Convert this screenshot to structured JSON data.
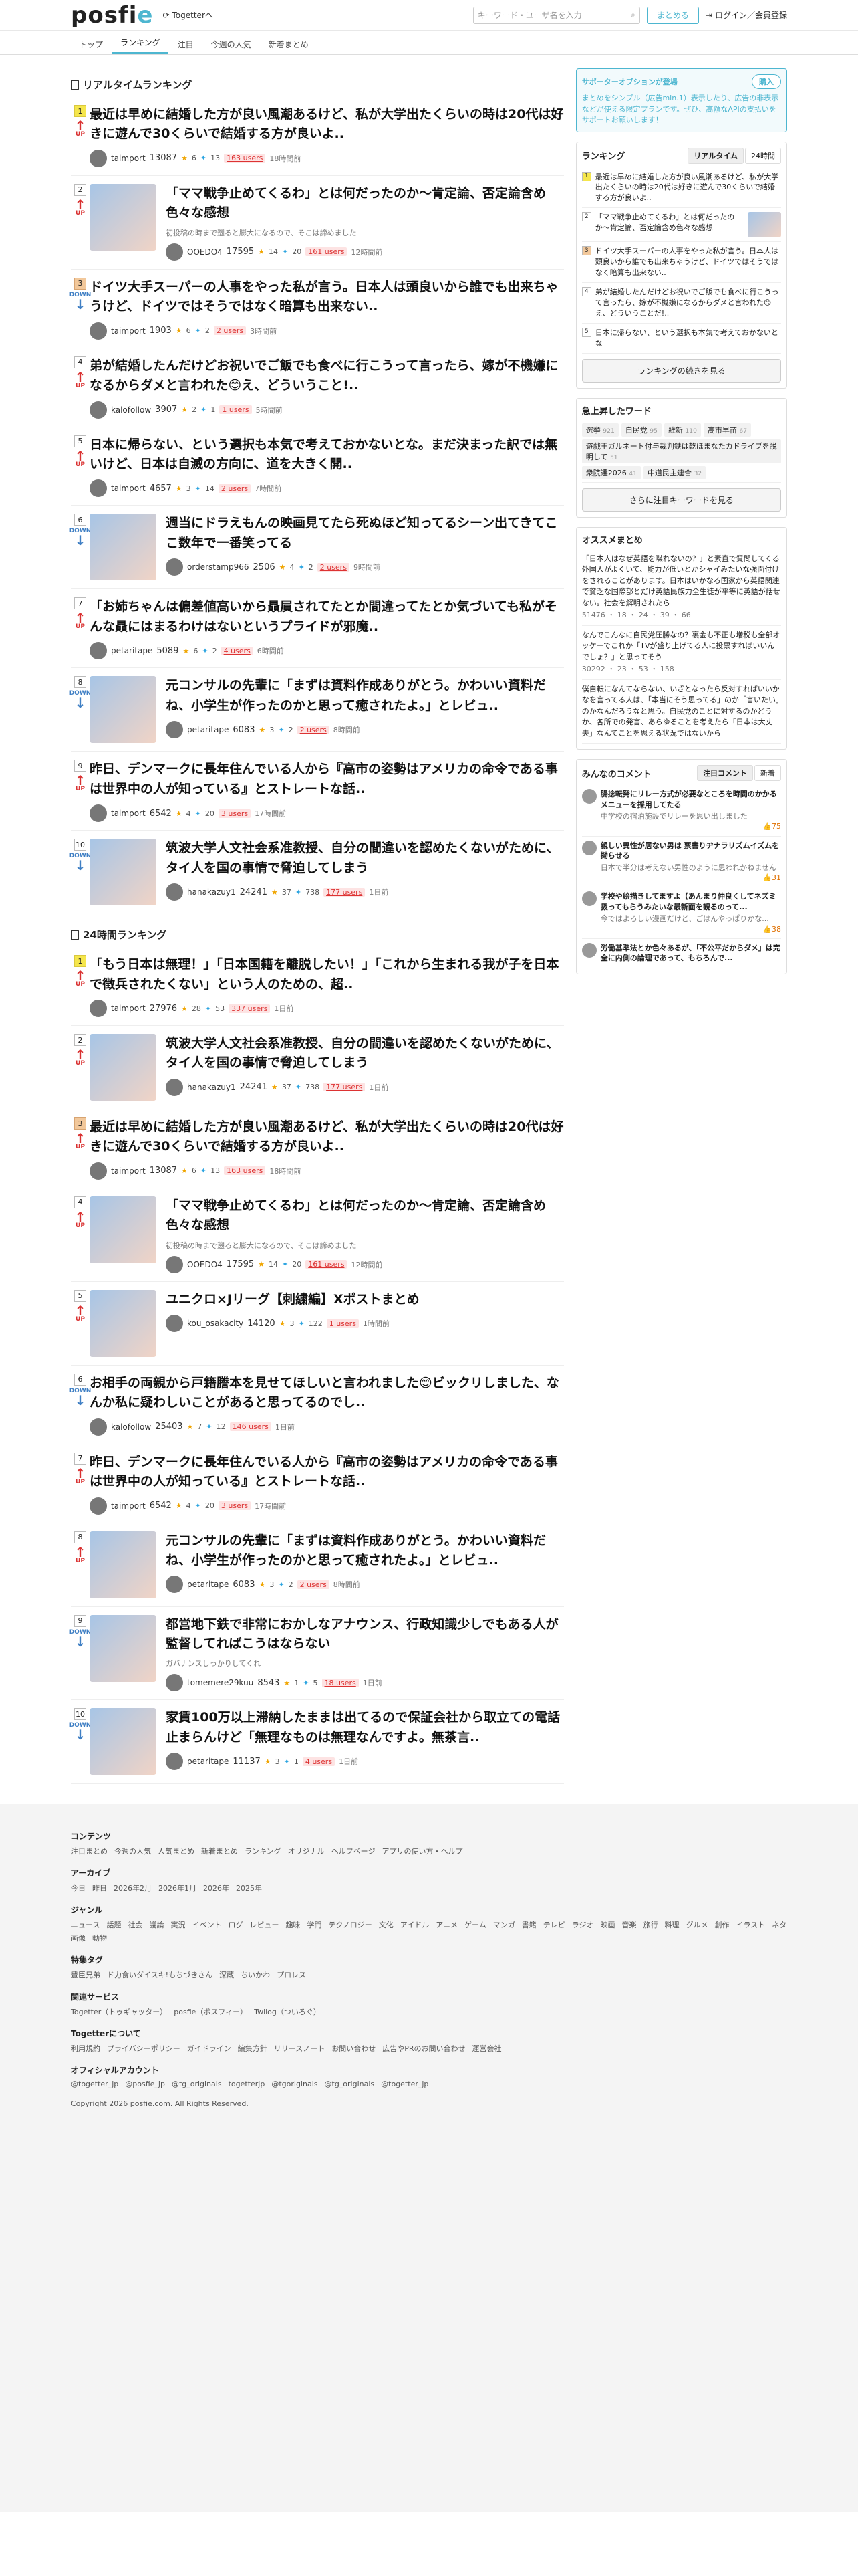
{
  "header": {
    "logo_main": "posfi",
    "logo_e": "e",
    "togetter_link": "Togetterへ",
    "search_placeholder": "キーワード・ユーザ名を入力",
    "matome_button": "まとめる",
    "login_label": "ログイン／会員登録"
  },
  "nav": [
    "トップ",
    "ランキング",
    "注目",
    "今週の人気",
    "新着まとめ"
  ],
  "realtime": {
    "title": "リアルタイムランキング",
    "items": [
      {
        "rank": "1",
        "trend": "UP",
        "title": "最近は早めに結婚した方が良い風潮あるけど、私が大学出たくらいの時は20代は好きに遊んで30くらいで結婚する方が良いよ..",
        "desc": "",
        "user": "taimport",
        "views": "13087",
        "likes": "6",
        "tw": "13",
        "users": "163 users",
        "time": "18時間前",
        "thumb": false
      },
      {
        "rank": "2",
        "trend": "UP",
        "title": "「ママ戦争止めてくるわ」とは何だったのか〜肯定論、否定論含め色々な感想",
        "desc": "初投稿の時まで遡ると膨大になるので、そこは諦めました",
        "user": "OOEDO4",
        "views": "17595",
        "likes": "14",
        "tw": "20",
        "users": "161 users",
        "time": "12時間前",
        "thumb": true
      },
      {
        "rank": "3",
        "trend": "DOWN",
        "title": "ドイツ大手スーパーの人事をやった私が言う。日本人は頭良いから誰でも出来ちゃうけど、ドイツではそうではなく暗算も出来ない..",
        "desc": "",
        "user": "taimport",
        "views": "1903",
        "likes": "6",
        "tw": "2",
        "users": "2 users",
        "time": "3時間前",
        "thumb": false
      },
      {
        "rank": "4",
        "trend": "UP",
        "title": "弟が結婚したんだけどお祝いでご飯でも食べに行こうって言ったら、嫁が不機嫌になるからダメと言われた😊え、どういうこと!..",
        "desc": "",
        "user": "kalofollow",
        "views": "3907",
        "likes": "2",
        "tw": "1",
        "users": "1 users",
        "time": "5時間前",
        "thumb": false
      },
      {
        "rank": "5",
        "trend": "UP",
        "title": "日本に帰らない、という選択も本気で考えておかないとな。まだ決まった訳では無いけど、日本は自滅の方向に、道を大きく開..",
        "desc": "",
        "user": "taimport",
        "views": "4657",
        "likes": "3",
        "tw": "14",
        "users": "2 users",
        "time": "7時間前",
        "thumb": false
      },
      {
        "rank": "6",
        "trend": "DOWN",
        "title": "週当にドラえもんの映画見てたら死ぬほど知ってるシーン出てきてここ数年で一番笑ってる",
        "desc": "",
        "user": "orderstamp966",
        "views": "2506",
        "likes": "4",
        "tw": "2",
        "users": "2 users",
        "time": "9時間前",
        "thumb": true
      },
      {
        "rank": "7",
        "trend": "UP",
        "title": "「お姉ちゃんは偏差値高いから贔屓されてたとか間違ってたとか気づいても私がそんな贔にはまるわけはないというプライドが邪魔..",
        "desc": "",
        "user": "petaritape",
        "views": "5089",
        "likes": "6",
        "tw": "2",
        "users": "4 users",
        "time": "6時間前",
        "thumb": false
      },
      {
        "rank": "8",
        "trend": "DOWN",
        "title": "元コンサルの先輩に「まずは資料作成ありがとう。かわいい資料だね、小学生が作ったのかと思って癒されたよ。」とレビュ..",
        "desc": "",
        "user": "petaritape",
        "views": "6083",
        "likes": "3",
        "tw": "2",
        "users": "2 users",
        "time": "8時間前",
        "thumb": true
      },
      {
        "rank": "9",
        "trend": "UP",
        "title": "昨日、デンマークに長年住んでいる人から『高市の姿勢はアメリカの命令である事は世界中の人が知っている』とストレートな話..",
        "desc": "",
        "user": "taimport",
        "views": "6542",
        "likes": "4",
        "tw": "20",
        "users": "3 users",
        "time": "17時間前",
        "thumb": false
      },
      {
        "rank": "10",
        "trend": "DOWN",
        "title": "筑波大学人文社会系准教授、自分の間違いを認めたくないがために、タイ人を国の事情で脅迫してしまう",
        "desc": "",
        "user": "hanakazuy1",
        "views": "24241",
        "likes": "37",
        "tw": "738",
        "users": "177 users",
        "time": "1日前",
        "thumb": true
      }
    ]
  },
  "daily": {
    "title": "24時間ランキング",
    "items": [
      {
        "rank": "1",
        "trend": "UP",
        "title": "「もう日本は無理！」「日本国籍を離脱したい！」「これから生まれる我が子を日本で徴兵されたくない」という人のための、超..",
        "desc": "",
        "user": "taimport",
        "views": "27976",
        "likes": "28",
        "tw": "53",
        "users": "337 users",
        "time": "1日前",
        "thumb": false
      },
      {
        "rank": "2",
        "trend": "UP",
        "title": "筑波大学人文社会系准教授、自分の間違いを認めたくないがために、タイ人を国の事情で脅迫してしまう",
        "desc": "",
        "user": "hanakazuy1",
        "views": "24241",
        "likes": "37",
        "tw": "738",
        "users": "177 users",
        "time": "1日前",
        "thumb": true
      },
      {
        "rank": "3",
        "trend": "UP",
        "title": "最近は早めに結婚した方が良い風潮あるけど、私が大学出たくらいの時は20代は好きに遊んで30くらいで結婚する方が良いよ..",
        "desc": "",
        "user": "taimport",
        "views": "13087",
        "likes": "6",
        "tw": "13",
        "users": "163 users",
        "time": "18時間前",
        "thumb": false
      },
      {
        "rank": "4",
        "trend": "UP",
        "title": "「ママ戦争止めてくるわ」とは何だったのか〜肯定論、否定論含め色々な感想",
        "desc": "初投稿の時まで遡ると膨大になるので、そこは諦めました",
        "user": "OOEDO4",
        "views": "17595",
        "likes": "14",
        "tw": "20",
        "users": "161 users",
        "time": "12時間前",
        "thumb": true
      },
      {
        "rank": "5",
        "trend": "UP",
        "title": "ユニクロ×Jリーグ【刺繍編】Xポストまとめ",
        "desc": "",
        "user": "kou_osakacity",
        "views": "14120",
        "likes": "3",
        "tw": "122",
        "users": "1 users",
        "time": "1時間前",
        "thumb": true
      },
      {
        "rank": "6",
        "trend": "DOWN",
        "title": "お相手の両親から戸籍謄本を見せてほしいと言われました😊ビックリしました、なんか私に疑わしいことがあると思ってるのでし..",
        "desc": "",
        "user": "kalofollow",
        "views": "25403",
        "likes": "7",
        "tw": "12",
        "users": "146 users",
        "time": "1日前",
        "thumb": false
      },
      {
        "rank": "7",
        "trend": "UP",
        "title": "昨日、デンマークに長年住んでいる人から『高市の姿勢はアメリカの命令である事は世界中の人が知っている』とストレートな話..",
        "desc": "",
        "user": "taimport",
        "views": "6542",
        "likes": "4",
        "tw": "20",
        "users": "3 users",
        "time": "17時間前",
        "thumb": false
      },
      {
        "rank": "8",
        "trend": "UP",
        "title": "元コンサルの先輩に「まずは資料作成ありがとう。かわいい資料だね、小学生が作ったのかと思って癒されたよ。」とレビュ..",
        "desc": "",
        "user": "petaritape",
        "views": "6083",
        "likes": "3",
        "tw": "2",
        "users": "2 users",
        "time": "8時間前",
        "thumb": true
      },
      {
        "rank": "9",
        "trend": "DOWN",
        "title": "都営地下鉄で非常におかしなアナウンス、行政知識少しでもある人が監督してればこうはならない",
        "desc": "ガバナンスしっかりしてくれ",
        "user": "tomemere29kuu",
        "views": "8543",
        "likes": "1",
        "tw": "5",
        "users": "18 users",
        "time": "1日前",
        "thumb": true
      },
      {
        "rank": "10",
        "trend": "DOWN",
        "title": "家賃100万以上滞納したままは出てるので保証会社から取立ての電話止まらんけど「無理なものは無理なんですよ。無茶言..",
        "desc": "",
        "user": "petaritape",
        "views": "11137",
        "likes": "3",
        "tw": "1",
        "users": "4 users",
        "time": "1日前",
        "thumb": true
      }
    ]
  },
  "sidebar": {
    "promo_title": "サポーターオプションが登場",
    "promo_button": "購入",
    "promo_text": "まとめをシンプル（広告min.1）表示したり、広告の非表示などが使える限定プランです。ぜひ、高額なAPIの支払いをサポートお願いします！",
    "ranking_title": "ランキング",
    "ranking_tabs": [
      "リアルタイム",
      "24時間"
    ],
    "ranking_items": [
      {
        "rank": "1",
        "title": "最近は早めに結婚した方が良い風潮あるけど、私が大学出たくらいの時は20代は好きに遊んで30くらいで結婚する方が良いよ..",
        "img": false
      },
      {
        "rank": "2",
        "title": "「ママ戦争止めてくるわ」とは何だったのか〜肯定論、否定論含め色々な感想",
        "img": true
      },
      {
        "rank": "3",
        "title": "ドイツ大手スーパーの人事をやった私が言う。日本人は頭良いから誰でも出来ちゃうけど、ドイツではそうではなく暗算も出来ない..",
        "img": false
      },
      {
        "rank": "4",
        "title": "弟が結婚したんだけどお祝いでご飯でも食べに行こうって言ったら、嫁が不機嫌になるからダメと言われた😊え、どういうことだ!..",
        "img": false
      },
      {
        "rank": "5",
        "title": "日本に帰らない、という選択も本気で考えておかないとな",
        "img": false
      }
    ],
    "ranking_more": "ランキングの続きを見る",
    "keywords_title": "急上昇したワード",
    "keywords": [
      {
        "w": "選挙",
        "c": "921"
      },
      {
        "w": "自民党",
        "c": "95"
      },
      {
        "w": "維新",
        "c": "110"
      },
      {
        "w": "高市早苗",
        "c": "67"
      },
      {
        "w": "遊戯王ガルネート付与裁判鉄は乾ほまなたカドライブを説明して",
        "c": "51"
      },
      {
        "w": "衆院選2026",
        "c": "41"
      },
      {
        "w": "中道民主連合",
        "c": "32"
      }
    ],
    "keywords_more": "さらに注目キーワードを見る",
    "osusume_title": "オススメまとめ",
    "osusume": [
      {
        "t": "「日本人はなぜ英語を喋れないの？」と素直で質問してくる外国人がよくいて、能力が低いとかシャイみたいな強面付けをされることがあります。日本はいかなる国家から英語関連で貧乏な国際部とだけ英語民族力全生徒が平等に英語が話せない。社会を解明されたら",
        "m": "51476 ・ 18 ・ 24 ・ 39 ・ 66"
      },
      {
        "t": "なんでこんなに自民党圧勝なの？裏金も不正も増税も全部オッケーでこれか「TVが盛り上げてる人に投票すればいいんでしょ？」と思ってそう",
        "m": "30292 ・ 23 ・ 53 ・ 158"
      },
      {
        "t": "僕自転になんてならない、いざとなったら反対すればいいかなを言ってる人は、「本当にそう思ってる」のか「言いたい」のかなんだろうなと思う。自民党のことに対するのかどうか、各所での発言、あらゆることを考えたら「日本は大丈夫」なんてことを思える状況ではないから",
        "m": ""
      }
    ],
    "comments_title": "みんなのコメント",
    "comments_tabs": [
      "注目コメント",
      "新着"
    ],
    "comments": [
      {
        "b": "腸捻転発にリレー方式が必要なところを時間のかかるメニューを採用してたる",
        "s": "中学校の宿泊施設でリレーを思い出しました",
        "l": "75"
      },
      {
        "b": "親しい異性が居ない男は 票書りヂナラリズムイズムを拗らせる",
        "s": "日本で半分は考えない男性のように思われかねません",
        "l": "31"
      },
      {
        "b": "学校や絵描きしてますよ【あんまり仲良くしてネズミ扱ってもらうみたいな最新面を観るのって...",
        "s": "今ではよろしい漫画だけど、ごはんやっぱりかな...",
        "l": "38"
      },
      {
        "b": "労働基準法とか色々あるが、「不公平だからダメ」は完全に内側の論理であって、もちろんで...",
        "s": "",
        "l": ""
      }
    ]
  },
  "footer": {
    "sections": [
      {
        "h": "コンテンツ",
        "links": [
          "注目まとめ",
          "今週の人気",
          "人気まとめ",
          "新着まとめ",
          "ランキング",
          "オリジナル",
          "ヘルプページ",
          "アプリの使い方・ヘルプ"
        ]
      },
      {
        "h": "アーカイブ",
        "links": [
          "今日",
          "昨日",
          "2026年2月",
          "2026年1月",
          "2026年",
          "2025年"
        ]
      },
      {
        "h": "ジャンル",
        "links": [
          "ニュース",
          "話題",
          "社会",
          "議論",
          "実況",
          "イベント",
          "ログ",
          "レビュー",
          "趣味",
          "学問",
          "テクノロジー",
          "文化",
          "アイドル",
          "アニメ",
          "ゲーム",
          "マンガ",
          "書籍",
          "テレビ",
          "ラジオ",
          "映画",
          "音楽",
          "旅行",
          "料理",
          "グルメ",
          "創作",
          "イラスト",
          "ネタ",
          "画像",
          "動物"
        ]
      },
      {
        "h": "特集タグ",
        "links": [
          "豊臣兄弟",
          "ド力食いダイスキ!もちづきさん",
          "深蔵",
          "ちいかわ",
          "プロレス"
        ]
      },
      {
        "h": "関連サービス",
        "links": [
          "Togetter（トゥギャッター）",
          "posfie（ポスフィー）",
          "Twilog（ついろぐ）"
        ]
      },
      {
        "h": "Togetterについて",
        "links": [
          "利用規約",
          "プライバシーポリシー",
          "ガイドライン",
          "編集方針",
          "リリースノート",
          "お問い合わせ",
          "広告やPRのお問い合わせ",
          "運営会社"
        ]
      },
      {
        "h": "オフィシャルアカウント",
        "links": [
          "@togetter_jp",
          "@posfie_jp",
          "@tg_originals",
          "togetterjp",
          "@tgoriginals",
          "@tg_originals",
          "@togetter_jp"
        ]
      }
    ],
    "copyright": "Copyright 2026 posfie.com. All Rights Reserved."
  }
}
